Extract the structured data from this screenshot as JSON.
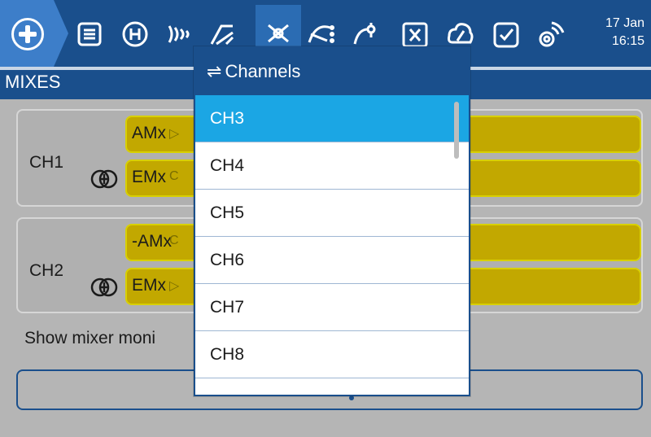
{
  "topbar": {
    "icons": [
      "model-setup-icon",
      "flight-modes-icon",
      "inputs-icon",
      "mixes-icon",
      "outputs-icon",
      "curves-icon",
      "global-variables-icon",
      "logical-switches-icon",
      "special-functions-icon",
      "checklist-icon",
      "telemetry-icon"
    ],
    "date": "17 Jan",
    "time": "16:15"
  },
  "section": {
    "title": "MIXES"
  },
  "mixes": [
    {
      "channel": "CH1",
      "lines": [
        {
          "name": "AMx",
          "symbol": "▷"
        },
        {
          "name": "EMx",
          "symbol": "C"
        }
      ]
    },
    {
      "channel": "CH2",
      "lines": [
        {
          "name": "-AMx",
          "symbol": "C"
        },
        {
          "name": "EMx",
          "symbol": "▷"
        }
      ]
    }
  ],
  "monitor": {
    "label": "Show mixer moni"
  },
  "dialog": {
    "title": "Channels",
    "items": [
      "CH3",
      "CH4",
      "CH5",
      "CH6",
      "CH7",
      "CH8"
    ],
    "selected": "CH3"
  },
  "colors": {
    "topbar": "#1a4f8c",
    "selected_item": "#1ba6e4",
    "mix_line": "#c2a800"
  }
}
